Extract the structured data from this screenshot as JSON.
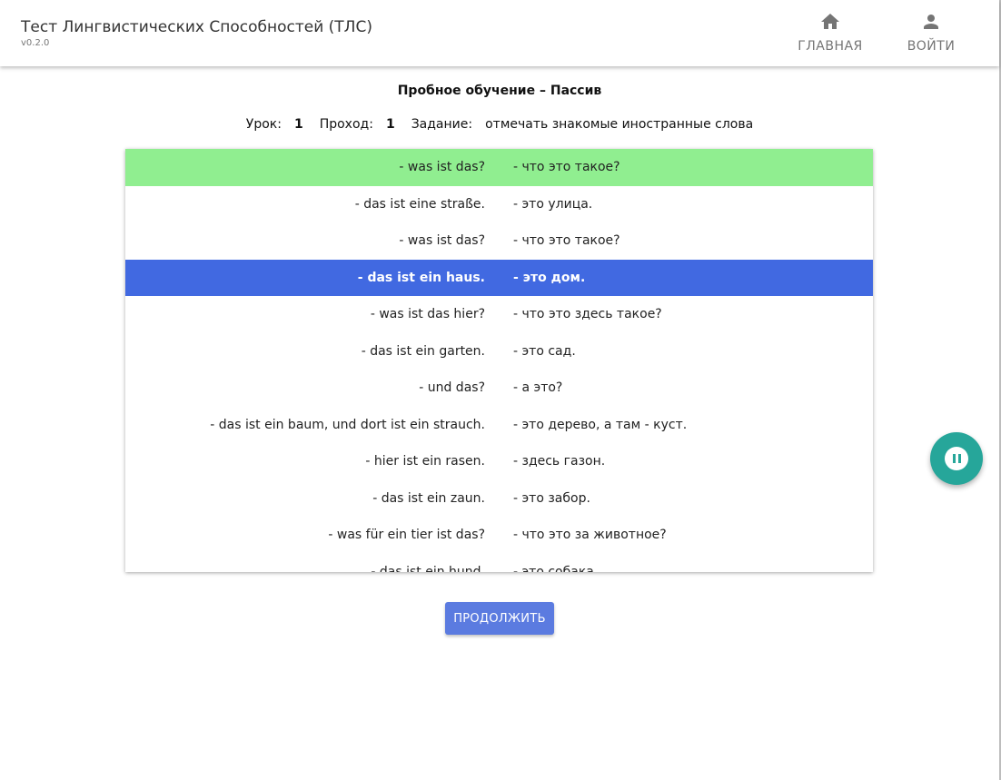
{
  "app": {
    "title": "Тест Лингвистических Способностей (ТЛС)",
    "version": "v0.2.0"
  },
  "nav": {
    "home_label": "ГЛАВНАЯ",
    "home_icon": "home-icon",
    "login_label": "ВОЙТИ",
    "login_icon": "person-icon"
  },
  "lesson": {
    "title": "Пробное обучение – Пассив",
    "lesson_label": "Урок:",
    "lesson_value": "1",
    "pass_label": "Проход:",
    "pass_value": "1",
    "task_label": "Задание:",
    "task_value": "отмечать знакомые иностранные слова"
  },
  "colors": {
    "known_row": "#90ee90",
    "current_row": "#4169e1",
    "button": "#5b7be0",
    "fab": "#26a69a"
  },
  "rows": [
    {
      "de": "- was ist das?",
      "ru": "- что это такое?",
      "state": "known"
    },
    {
      "de": "- das ist eine straße.",
      "ru": "- это улица.",
      "state": ""
    },
    {
      "de": "- was ist das?",
      "ru": "- что это такое?",
      "state": ""
    },
    {
      "de": "- das ist ein haus.",
      "ru": "- это дом.",
      "state": "current"
    },
    {
      "de": "- was ist das hier?",
      "ru": "- что это здесь такое?",
      "state": ""
    },
    {
      "de": "- das ist ein garten.",
      "ru": "- это сад.",
      "state": ""
    },
    {
      "de": "- und das?",
      "ru": "- а это?",
      "state": ""
    },
    {
      "de": "- das ist ein baum, und dort ist ein strauch.",
      "ru": "- это дерево, а там - куст.",
      "state": ""
    },
    {
      "de": "- hier ist ein rasen.",
      "ru": "- здесь газон.",
      "state": ""
    },
    {
      "de": "- das ist ein zaun.",
      "ru": "- это забор.",
      "state": ""
    },
    {
      "de": "- was für ein tier ist das?",
      "ru": "- что это за животное?",
      "state": ""
    },
    {
      "de": "- das ist ein hund.",
      "ru": "- это собака.",
      "state": ""
    }
  ],
  "continue_label": "ПРОДОЛЖИТЬ",
  "fab_icon": "pause-icon"
}
